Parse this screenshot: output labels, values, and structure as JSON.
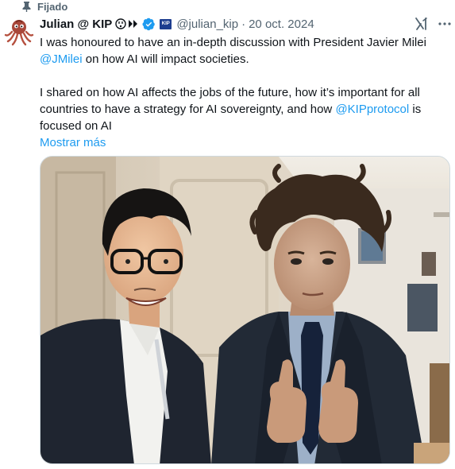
{
  "pinned": {
    "label": "Fijado",
    "icon": "pin-icon"
  },
  "author": {
    "name": "Julian @ KIP",
    "name_glyphs": "😵⋙",
    "verified_icon": "verified-badge-icon",
    "org_badge_text": "KIP",
    "handle": "@julian_kip",
    "separator": "·",
    "date": "20 oct. 2024"
  },
  "tweet": {
    "line1_prefix": "I was honoured to have an in-depth discussion with President Javier Milei",
    "mention1": "@JMilei",
    "line2_suffix": " on how AI will impact societies.",
    "para2_prefix": "I shared on how AI affects the jobs of the future, how it’s important for all countries to have a strategy for AI sovereignty, and how ",
    "mention2": "@KIPprotocol",
    "para2_suffix": " is focused on AI",
    "show_more": "Mostrar más"
  },
  "icons": {
    "grok": "grok-icon",
    "more": "more-options-icon"
  },
  "colors": {
    "link": "#1d9bf0",
    "secondary_text": "#536471",
    "primary_text": "#0f1419"
  }
}
